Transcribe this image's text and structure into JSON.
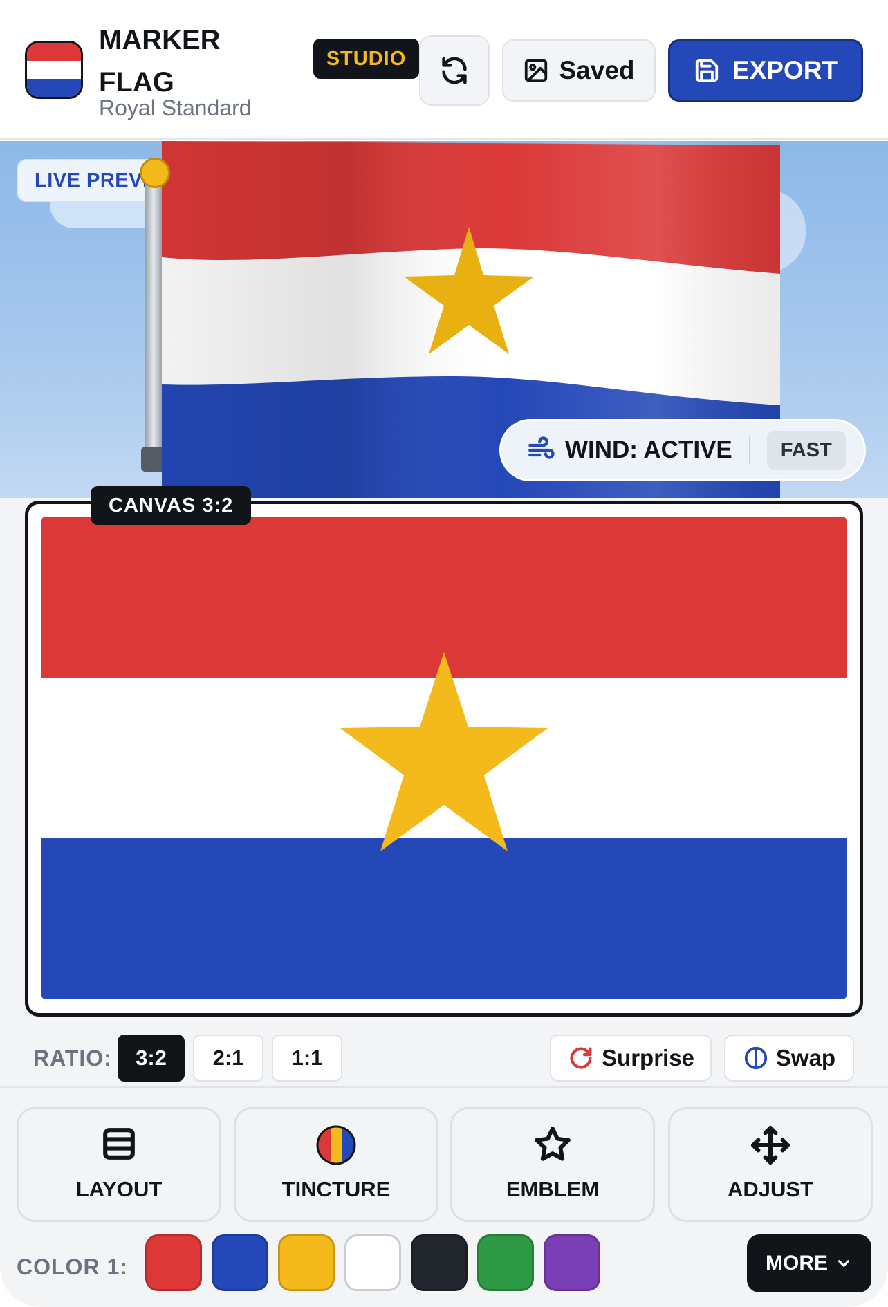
{
  "app": {
    "title": "MARKER FLAG",
    "subtitle": "Royal Standard",
    "badge": "STUDIO"
  },
  "header": {
    "refresh_icon": "refresh-icon",
    "saved_label": "Saved",
    "saved_icon": "image-icon",
    "export_label": "EXPORT",
    "export_icon": "save-icon"
  },
  "preview": {
    "live_label": "LIVE PREVIEW",
    "wind_label": "WIND: ACTIVE",
    "wind_icon": "wind-icon",
    "speed": "FAST"
  },
  "canvas": {
    "tag": "CANVAS 3:2",
    "flag": {
      "stripes": [
        "#dc3838",
        "#ffffff",
        "#2448b8"
      ],
      "emblem": "star",
      "emblem_color": "#f4b91a"
    }
  },
  "ratio": {
    "label": "RATIO:",
    "options": [
      "3:2",
      "2:1",
      "1:1"
    ],
    "selected": "3:2",
    "surprise_label": "Surprise",
    "swap_label": "Swap"
  },
  "tools": [
    {
      "label": "LAYOUT",
      "icon": "layout-icon"
    },
    {
      "label": "TINCTURE",
      "icon": "tincture-icon"
    },
    {
      "label": "EMBLEM",
      "icon": "star-icon"
    },
    {
      "label": "ADJUST",
      "icon": "move-icon"
    }
  ],
  "colors": {
    "label": "COLOR 1:",
    "swatches": [
      "#dc3838",
      "#2448b8",
      "#f4b91a",
      "#ffffff",
      "#22262d",
      "#2e9a45",
      "#7b3fb5"
    ],
    "more_label": "MORE"
  }
}
